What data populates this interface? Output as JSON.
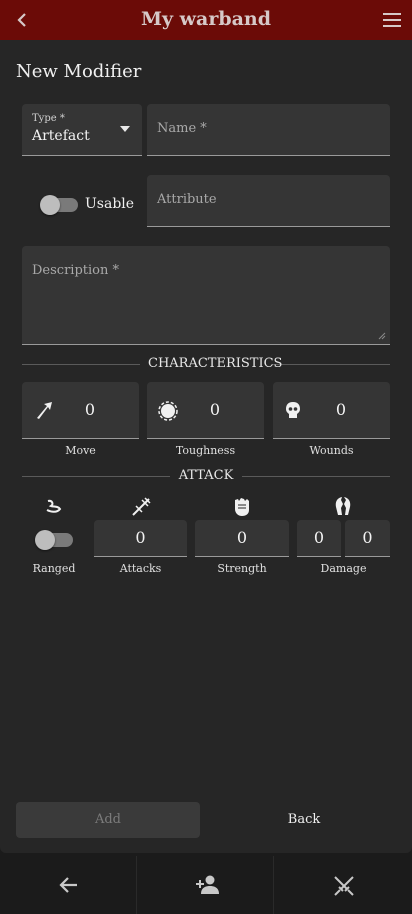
{
  "app": {
    "title": "My warband"
  },
  "page": {
    "heading": "New Modifier"
  },
  "form": {
    "type_label": "Type *",
    "type_value": "Artefact",
    "name_label": "Name *",
    "usable_label": "Usable",
    "attribute_label": "Attribute",
    "description_label": "Description *"
  },
  "characteristics": {
    "title": "CHARACTERISTICS",
    "items": [
      {
        "label": "Move",
        "value": "0",
        "icon": "arrow-icon"
      },
      {
        "label": "Toughness",
        "value": "0",
        "icon": "shield-icon"
      },
      {
        "label": "Wounds",
        "value": "0",
        "icon": "skull-icon"
      }
    ]
  },
  "attack": {
    "title": "ATTACK",
    "ranged_label": "Ranged",
    "attacks_label": "Attacks",
    "attacks_value": "0",
    "strength_label": "Strength",
    "strength_value": "0",
    "damage_label": "Damage",
    "damage_min": "0",
    "damage_max": "0"
  },
  "actions": {
    "add_label": "Add",
    "back_label": "Back"
  },
  "colors": {
    "topbar": "#6b0b07",
    "background": "#1b1b1b",
    "card": "#262626",
    "field": "#353535"
  },
  "nav": {
    "items": [
      "back-arrow-icon",
      "add-person-icon",
      "crossed-swords-icon"
    ]
  }
}
